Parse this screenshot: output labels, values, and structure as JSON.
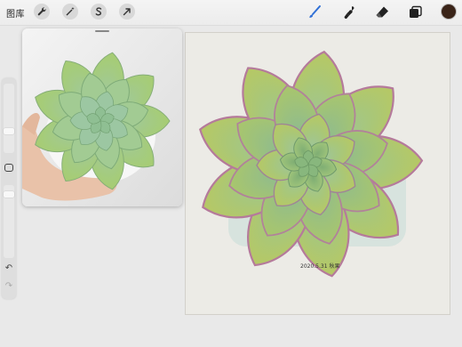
{
  "toolbar": {
    "gallery_label": "图库",
    "actions_icon": "wrench-icon",
    "adjustments_icon": "magic-wand-icon",
    "selection_icon": "selection-s-icon",
    "transform_icon": "arrow-cursor-icon",
    "brush_icon": "brush-icon",
    "smudge_icon": "smudge-icon",
    "eraser_icon": "eraser-icon",
    "layers_icon": "layers-icon",
    "active_tool_color": "#2f6fd6",
    "current_color": "#3a2418"
  },
  "sidebar": {
    "modifier_icon": "square-modifier-icon",
    "undo_icon": "undo-icon",
    "redo_icon": "redo-icon",
    "brush_size_level": 0.3,
    "opacity_level": 0.9
  },
  "canvas": {
    "subject": "succulent-painting",
    "signature_text": "2020.5.31 秋果"
  },
  "reference": {
    "subject": "succulent-photo"
  }
}
